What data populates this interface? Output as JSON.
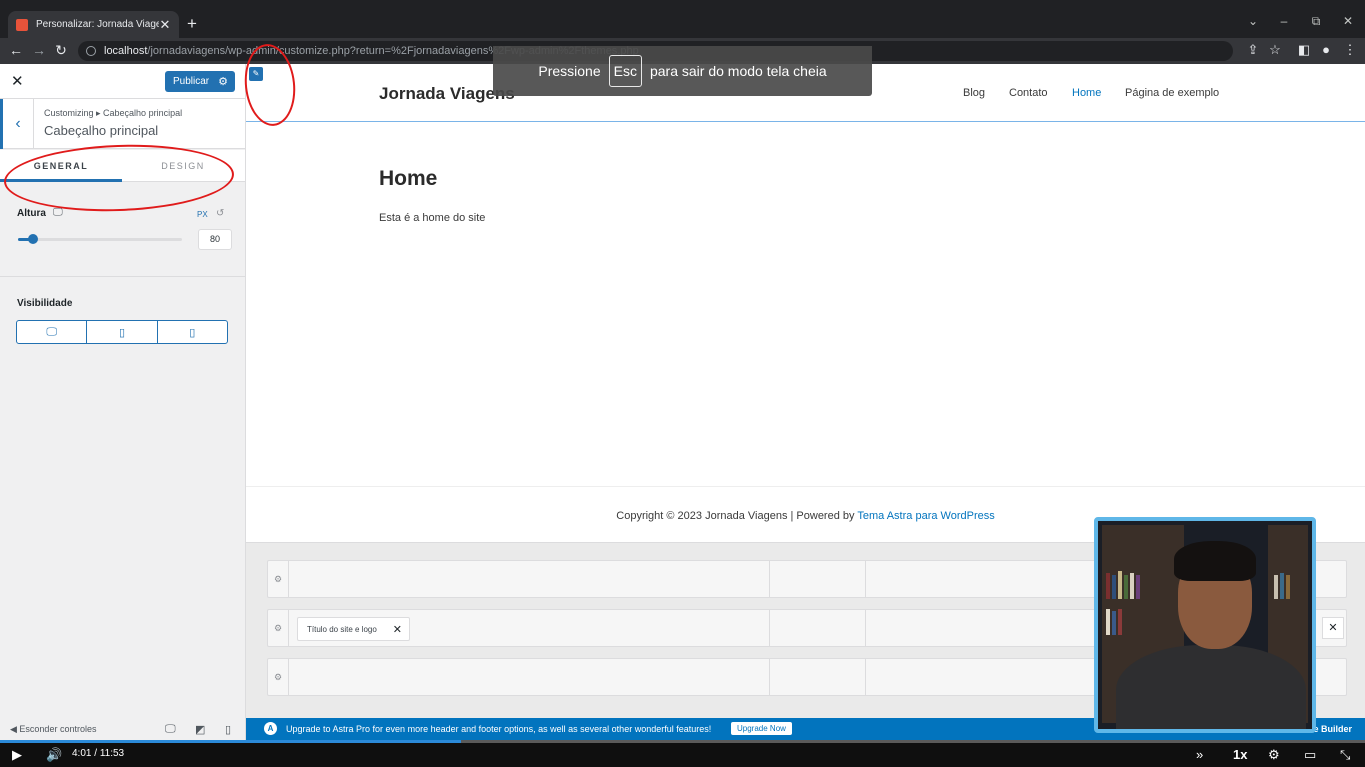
{
  "browser": {
    "tab_title": "Personalizar: Jornada Viagens",
    "tab_close": "✕",
    "new_tab": "+",
    "url_host": "localhost",
    "url_path": "/jornadaviagens/wp-admin/customize.php?return=%2Fjornadaviagens%2Fwp-admin%2Fthemes.php"
  },
  "fullscreen_notice": {
    "before": "Pressione",
    "key": "Esc",
    "after": "para sair do modo tela cheia"
  },
  "customizer": {
    "close": "✕",
    "publish_label": "Publicar",
    "breadcrumb": "Customizing ▸ Cabeçalho principal",
    "section_title": "Cabeçalho principal",
    "tabs": [
      "GENERAL",
      "DESIGN"
    ],
    "height_label": "Altura",
    "unit": "PX",
    "height_value": "80",
    "height_fraction": 0.09,
    "visibility_label": "Visibilidade",
    "hide_controls": "Esconder controles"
  },
  "site": {
    "title": "Jornada Viagens",
    "menu": [
      "Blog",
      "Contato",
      "Home",
      "Página de exemplo"
    ],
    "current_menu": "Home",
    "page_heading": "Home",
    "page_text": "Esta é a home do site",
    "copyright_text": "Copyright © 2023 Jornada Viagens | Powered by ",
    "copyright_link": "Tema Astra para WordPress"
  },
  "builder": {
    "item_label": "Título do site e logo",
    "upgrade_text": "Upgrade to Astra Pro for even more header and footer options, as well as several other wonderful features!",
    "upgrade_button": "Upgrade Now",
    "hide_builder": "Hide Builder"
  },
  "video": {
    "current_time": "4:01",
    "separator": "/",
    "duration": "11:53",
    "speed": "1x",
    "progress_fraction": 0.338
  },
  "colors": {
    "accent": "#2271b1",
    "link": "#0274be",
    "annotation": "#e01b1b"
  }
}
